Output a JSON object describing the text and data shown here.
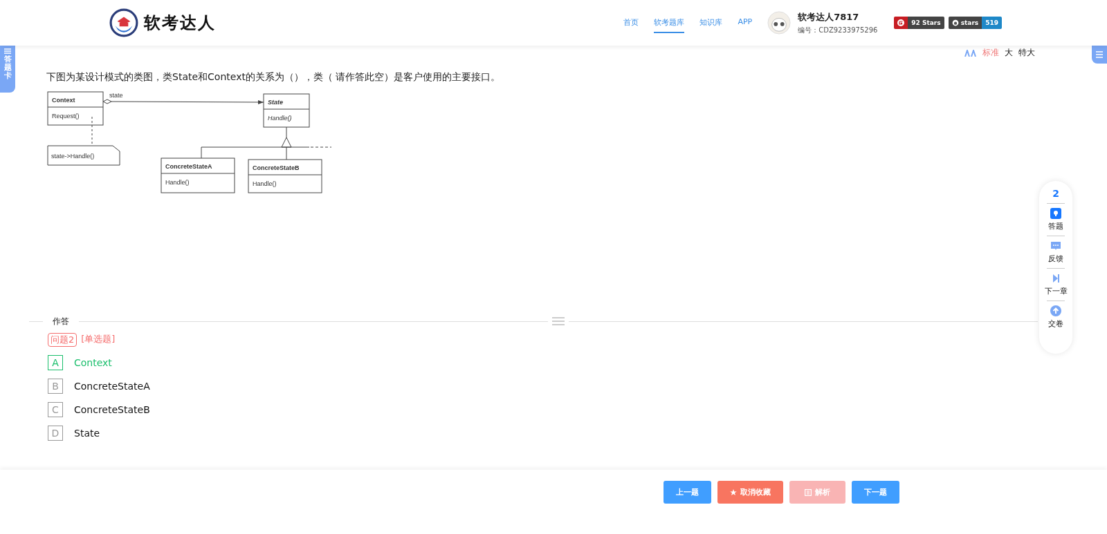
{
  "header": {
    "logo_text": "软考达人",
    "nav": [
      {
        "label": "首页",
        "selected": false
      },
      {
        "label": "软考题库",
        "selected": true
      },
      {
        "label": "知识库",
        "selected": false
      },
      {
        "label": "APP",
        "selected": false
      }
    ],
    "user": {
      "name": "软考达人7817",
      "id": "编号：CDZ9233975296"
    },
    "badges": [
      {
        "label": "92 Stars",
        "kind": "gitee"
      },
      {
        "label": "stars",
        "count": "519",
        "kind": "github"
      }
    ]
  },
  "answer_card_tab": "答题卡",
  "font_sizes": [
    {
      "label": "标准",
      "selected": true
    },
    {
      "label": "大",
      "selected": false
    },
    {
      "label": "特大",
      "selected": false
    }
  ],
  "question": {
    "text": "下图为某设计模式的类图，类State和Context的关系为（），类（ 请作答此空）是客户使用的主要接口。",
    "diagram": {
      "classes": [
        {
          "name": "Context",
          "method": "Request()",
          "abstract": false
        },
        {
          "name": "State",
          "method": "Handle()",
          "abstract": true
        },
        {
          "name": "ConcreteStateA",
          "method": "Handle()",
          "abstract": false
        },
        {
          "name": "ConcreteStateB",
          "method": "Handle()",
          "abstract": false
        }
      ],
      "role": "state",
      "note": "state->Handle()"
    }
  },
  "answer": {
    "section_label": "作答",
    "number": "问题2",
    "type": "[单选题]",
    "options": [
      {
        "letter": "A",
        "text": "Context",
        "selected": true
      },
      {
        "letter": "B",
        "text": "ConcreteStateA",
        "selected": false
      },
      {
        "letter": "C",
        "text": "ConcreteStateB",
        "selected": false
      },
      {
        "letter": "D",
        "text": "State",
        "selected": false
      }
    ]
  },
  "side_panel": {
    "count": "2",
    "items": [
      {
        "label": "答题",
        "kind": "answer"
      },
      {
        "label": "反馈",
        "kind": "feedback"
      },
      {
        "label": "下一章",
        "kind": "next"
      },
      {
        "label": "交卷",
        "kind": "submit"
      }
    ]
  },
  "buttons": [
    {
      "label": "上一题",
      "kind": "primary",
      "disabled": false
    },
    {
      "label": "取消收藏",
      "kind": "favorite",
      "disabled": false
    },
    {
      "label": "解析",
      "kind": "analysis",
      "disabled": true
    },
    {
      "label": "下一题",
      "kind": "primary",
      "disabled": false
    }
  ]
}
